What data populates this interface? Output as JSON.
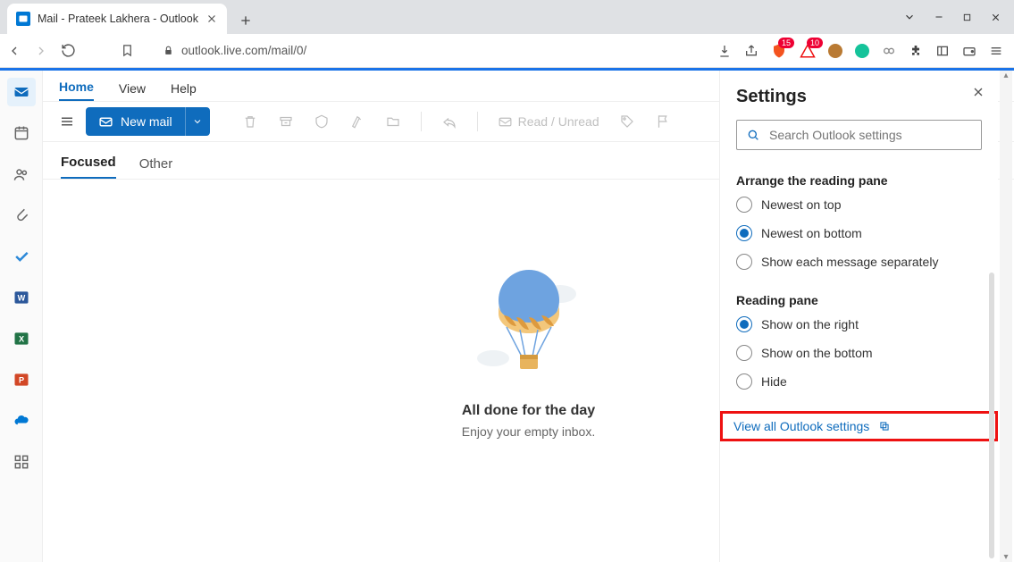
{
  "browser": {
    "tab_title": "Mail - Prateek Lakhera - Outlook",
    "url": "outlook.live.com/mail/0/",
    "brave_badge": "15",
    "alert_badge": "10"
  },
  "leftrail": {
    "items": [
      "mail",
      "calendar",
      "people",
      "files",
      "todo",
      "word",
      "excel",
      "powerpoint",
      "onedrive",
      "apps"
    ]
  },
  "menubar": {
    "home": "Home",
    "view": "View",
    "help": "Help"
  },
  "toolbar": {
    "newmail_label": "New mail",
    "readunread_label": "Read / Unread"
  },
  "tabs": {
    "focused": "Focused",
    "other": "Other"
  },
  "empty": {
    "title": "All done for the day",
    "subtitle": "Enjoy your empty inbox."
  },
  "settings": {
    "title": "Settings",
    "search_placeholder": "Search Outlook settings",
    "arrange_title": "Arrange the reading pane",
    "arrange_options": {
      "newest_top": "Newest on top",
      "newest_bottom": "Newest on bottom",
      "separately": "Show each message separately"
    },
    "reading_title": "Reading pane",
    "reading_options": {
      "right": "Show on the right",
      "bottom": "Show on the bottom",
      "hide": "Hide"
    },
    "view_all": "View all Outlook settings"
  }
}
